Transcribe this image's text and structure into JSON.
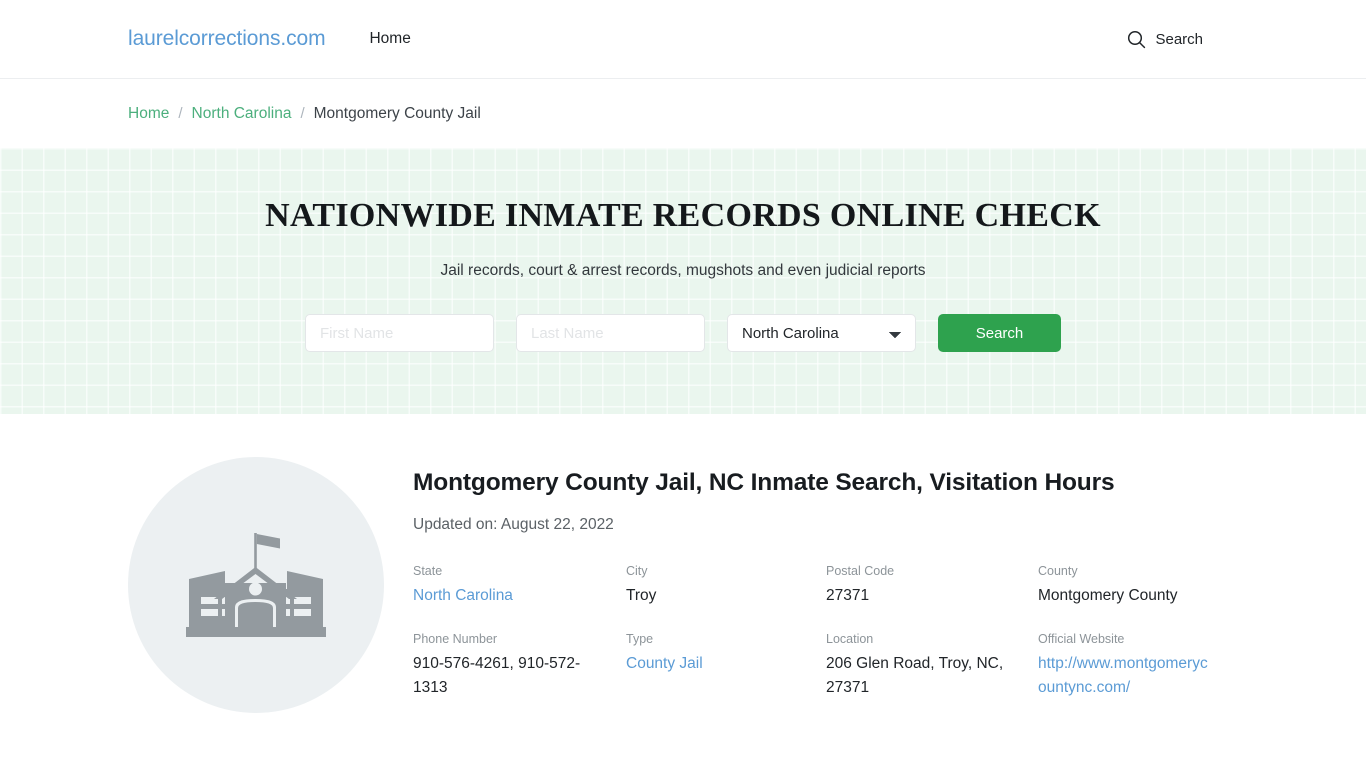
{
  "header": {
    "brand": "laurelcorrections.com",
    "nav": [
      {
        "label": "Home"
      }
    ],
    "search_label": "Search",
    "search_icon": "search-icon"
  },
  "breadcrumb": {
    "items": [
      {
        "label": "Home",
        "current": false
      },
      {
        "label": "North Carolina",
        "current": false
      },
      {
        "label": "Montgomery County Jail",
        "current": true
      }
    ],
    "separator": "/"
  },
  "hero": {
    "title": "NATIONWIDE INMATE RECORDS ONLINE CHECK",
    "subtitle": "Jail records, court & arrest records, mugshots and even judicial reports",
    "form": {
      "first_name_placeholder": "First Name",
      "first_name_value": "",
      "last_name_placeholder": "Last Name",
      "last_name_value": "",
      "state_selected": "North Carolina",
      "state_options": [
        "North Carolina"
      ],
      "submit_label": "Search"
    },
    "background_color": "#eaf6ee",
    "accent_color": "#2ea24e"
  },
  "main": {
    "avatar_icon": "courthouse-building-icon",
    "title": "Montgomery County Jail, NC Inmate Search, Visitation Hours",
    "updated": "Updated on: August 22, 2022",
    "fields": [
      {
        "label": "State",
        "value": "North Carolina",
        "is_link": true
      },
      {
        "label": "City",
        "value": "Troy",
        "is_link": false
      },
      {
        "label": "Postal Code",
        "value": "27371",
        "is_link": false
      },
      {
        "label": "County",
        "value": "Montgomery County",
        "is_link": false
      },
      {
        "label": "Phone Number",
        "value": "910-576-4261, 910-572-1313",
        "is_link": false
      },
      {
        "label": "Type",
        "value": "County Jail",
        "is_link": true
      },
      {
        "label": "Location",
        "value": "206 Glen Road, Troy, NC, 27371",
        "is_link": false
      },
      {
        "label": "Official Website",
        "value": "http://www.montgomerycountync.com/",
        "is_link": true
      }
    ],
    "link_color": "#5b9bd5"
  }
}
